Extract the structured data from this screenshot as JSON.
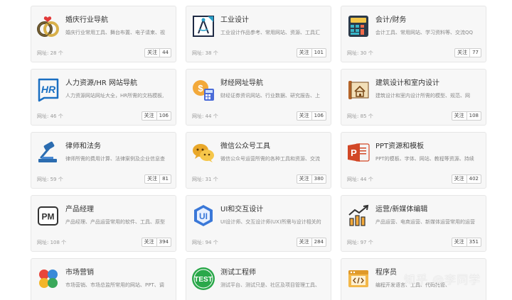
{
  "follow_label": "关注",
  "watermark": "知乎 @李同学",
  "cards": [
    {
      "title": "婚庆行业导航",
      "desc": "婚庆行业常用工具、舞台布置、电子请柬、视",
      "count": "网址: 28 个",
      "follows": "44",
      "icon": "wedding-rings-icon"
    },
    {
      "title": "工业设计",
      "desc": "工业设计作品参考、常用网站、资源、工具汇",
      "count": "网址: 38 个",
      "follows": "101",
      "icon": "compass-drawing-icon"
    },
    {
      "title": "会计/财务",
      "desc": "会计工具、常用网站、学习资料等、交流QQ",
      "count": "网址: 30 个",
      "follows": "77",
      "icon": "calculator-icon"
    },
    {
      "title": "人力资源/HR 网站导航",
      "desc": "人力资源网站网址大全，HR所需的文档模板,",
      "count": "网址: 46 个",
      "follows": "106",
      "icon": "hr-icon"
    },
    {
      "title": "财经网址导航",
      "desc": "财经证券资讯网站、行业数据、研究报告、上",
      "count": "网址: 44 个",
      "follows": "106",
      "icon": "money-calculator-icon"
    },
    {
      "title": "建筑设计和室内设计",
      "desc": "建筑设计和室内设计所需的模型、规范、网",
      "count": "网址: 85 个",
      "follows": "108",
      "icon": "blueprint-house-icon"
    },
    {
      "title": "律师和法务",
      "desc": "律师所需的费用计算、法律案例及企业信息查",
      "count": "网址: 59 个",
      "follows": "81",
      "icon": "gavel-icon"
    },
    {
      "title": "微信公众号工具",
      "desc": "微信公众号运营所需的各种工具和资源、交流",
      "count": "网址: 31 个",
      "follows": "380",
      "icon": "wechat-icon"
    },
    {
      "title": "PPT资源和模板",
      "desc": "PPT的模板、字体、网站、教程等资源、持续",
      "count": "网址: 44 个",
      "follows": "402",
      "icon": "powerpoint-icon"
    },
    {
      "title": "产品经理",
      "desc": "产品经理、产品运营常用的软件、工具、原型",
      "count": "网址: 108 个",
      "follows": "394",
      "icon": "pm-icon"
    },
    {
      "title": "UI和交互设计",
      "desc": "UI设计师、交互设计师(UX)所需与设计相关的",
      "count": "网址: 94 个",
      "follows": "284",
      "icon": "ui-shield-icon"
    },
    {
      "title": "运营/新媒体编辑",
      "desc": "产品运营、电商运营、新媒体运营常用的运营",
      "count": "网址: 97 个",
      "follows": "351",
      "icon": "growth-chart-icon"
    },
    {
      "title": "市场营销",
      "desc": "市场营销、市场总监所常用的网站、PPT、调",
      "count": "",
      "follows": "",
      "icon": "petals-icon"
    },
    {
      "title": "测试工程师",
      "desc": "测试平台、测试只是、社区及项目管理工具、",
      "count": "",
      "follows": "",
      "icon": "test-badge-icon"
    },
    {
      "title": "程序员",
      "desc": "编程开发语言、工具、代码托管、",
      "count": "",
      "follows": "",
      "icon": "code-window-icon"
    }
  ]
}
